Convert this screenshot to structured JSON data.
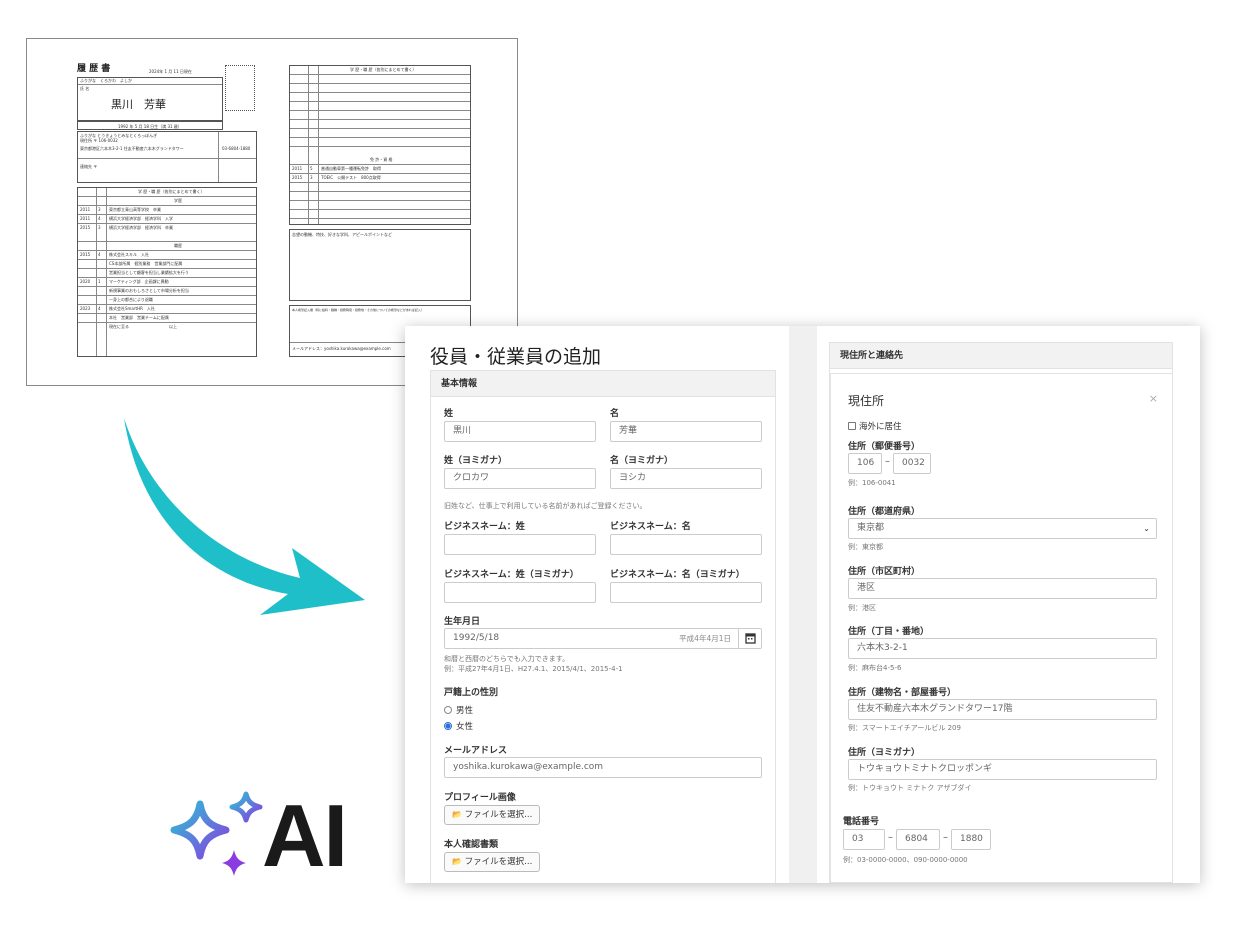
{
  "resume": {
    "title": "履 歴 書",
    "date": "2024年 1 月 11 日現在",
    "furigana_row": "ふりがな　くろかわ　よしか",
    "name_label": "氏 名",
    "name": "黒川　芳華",
    "birth": "1992 年 5 月 18 日生（満 31 歳）",
    "address_furigana": "ふりがな とうきょうとみなとくろっぽんぎ",
    "address_postal": "現住所 〒 106-0032",
    "address": "東京都港区六本木3-2-1 住友不動産六本木グランドタワー",
    "phone": "03-6804-1880",
    "contact_label": "連絡先 〒",
    "history_header": "学 歴・職 歴（各別にまとめて書く）",
    "edu_label": "学歴",
    "work_label": "職歴",
    "rows_left": [
      {
        "year": "2011",
        "month": "3",
        "text": "東京都立青山高等学校　卒業"
      },
      {
        "year": "2011",
        "month": "4",
        "text": "横浜大学経済学部　経済学科　入学"
      },
      {
        "year": "2015",
        "month": "3",
        "text": "横浜大学経済学部　経済学科　卒業"
      },
      {
        "year": "2015",
        "month": "4",
        "text": "株式会社スキル　入社"
      },
      {
        "year": "",
        "month": "",
        "text": "CS本部所属　個別業務　営業部門に配属"
      },
      {
        "year": "",
        "month": "",
        "text": "営業担当として顧客を担当し業績拡大を行う"
      },
      {
        "year": "2020",
        "month": "1",
        "text": "マーケティング部　企画課に異動"
      },
      {
        "year": "",
        "month": "",
        "text": "新規事業のおもしろさとして市場分析を担当"
      },
      {
        "year": "",
        "month": "",
        "text": "一身上の都合により退職"
      },
      {
        "year": "2023",
        "month": "4",
        "text": "株式会社SmartHR　入社"
      },
      {
        "year": "",
        "month": "",
        "text": "本社　営業部　営業チームに配属"
      },
      {
        "year": "",
        "month": "",
        "text": "現在に至る　　　　　　　　　　以上"
      }
    ],
    "license_header": "免 許・資 格",
    "licenses": [
      {
        "year": "2011",
        "month": "5",
        "text": "普通自動車第一種運転免許　取得"
      },
      {
        "year": "2015",
        "month": "3",
        "text": "TOEIC　公開テスト　800点取得"
      }
    ],
    "motivation_label": "志望の動機、特技、好きな学科、アピールポイントなど",
    "request_label": "本人希望記入欄（特に給料・職種・勤務時間・勤務地・その他についての希望などがあれば記入）",
    "email_label": "メールアドレス：yoshika.kurokawa@example.com"
  },
  "logo": {
    "text": "AI"
  },
  "app": {
    "page_title": "役員・従業員の追加",
    "basic": {
      "header": "基本情報",
      "last_name_label": "姓",
      "last_name_value": "黒川",
      "first_name_label": "名",
      "first_name_value": "芳華",
      "last_kana_label": "姓（ヨミガナ）",
      "last_kana_value": "クロカワ",
      "first_kana_label": "名（ヨミガナ）",
      "first_kana_value": "ヨシカ",
      "business_hint": "旧姓など、仕事上で利用している名前があればご登録ください。",
      "biz_last_label": "ビジネスネーム：姓",
      "biz_first_label": "ビジネスネーム：名",
      "biz_last_kana_label": "ビジネスネーム：姓（ヨミガナ）",
      "biz_first_kana_label": "ビジネスネーム：名（ヨミガナ）",
      "birth_label": "生年月日",
      "birth_value": "1992/5/18",
      "birth_wareki": "平成4年4月1日",
      "birth_hint1": "和暦と西暦のどちらでも入力できます。",
      "birth_hint2": "例：平成27年4月1日、H27.4.1、2015/4/1、2015-4-1",
      "gender_label": "戸籍上の性別",
      "gender_male": "男性",
      "gender_female": "女性",
      "gender_selected": "女性",
      "email_label": "メールアドレス",
      "email_value": "yoshika.kurokawa@example.com",
      "profile_label": "プロフィール画像",
      "file_button": "ファイルを選択...",
      "id_doc_label": "本人確認書類",
      "file_button2": "ファイルを選択..."
    },
    "address": {
      "header": "現住所と連絡先",
      "card_title": "現住所",
      "close": "×",
      "overseas_label": "海外に居住",
      "postal_label": "住所（郵便番号）",
      "postal1": "106",
      "postal2": "0032",
      "postal_hint": "例：106-0041",
      "pref_label": "住所（都道府県）",
      "pref_value": "東京都",
      "pref_hint": "例：東京都",
      "city_label": "住所（市区町村）",
      "city_value": "港区",
      "city_hint": "例：港区",
      "street_label": "住所（丁目・番地）",
      "street_value": "六本木3-2-1",
      "street_hint": "例：麻布台4-5-6",
      "building_label": "住所（建物名・部屋番号）",
      "building_value": "住友不動産六本木グランドタワー17階",
      "building_hint": "例：スマートエイチアールビル 209",
      "kana_label": "住所（ヨミガナ）",
      "kana_value": "トウキョウトミナトクロッポンギ",
      "kana_hint": "例：トウキョウト ミナトク アザブダイ",
      "phone_label": "電話番号",
      "phone1": "03",
      "phone2": "6804",
      "phone3": "1880",
      "phone_hint": "例：03-0000-0000、090-0000-0000"
    }
  },
  "colors": {
    "arrow": "#1fbfc9",
    "ai_sparkle_start": "#2bc3d4",
    "ai_sparkle_end": "#8a3ce0",
    "radio_accent": "#2f6fd6"
  }
}
